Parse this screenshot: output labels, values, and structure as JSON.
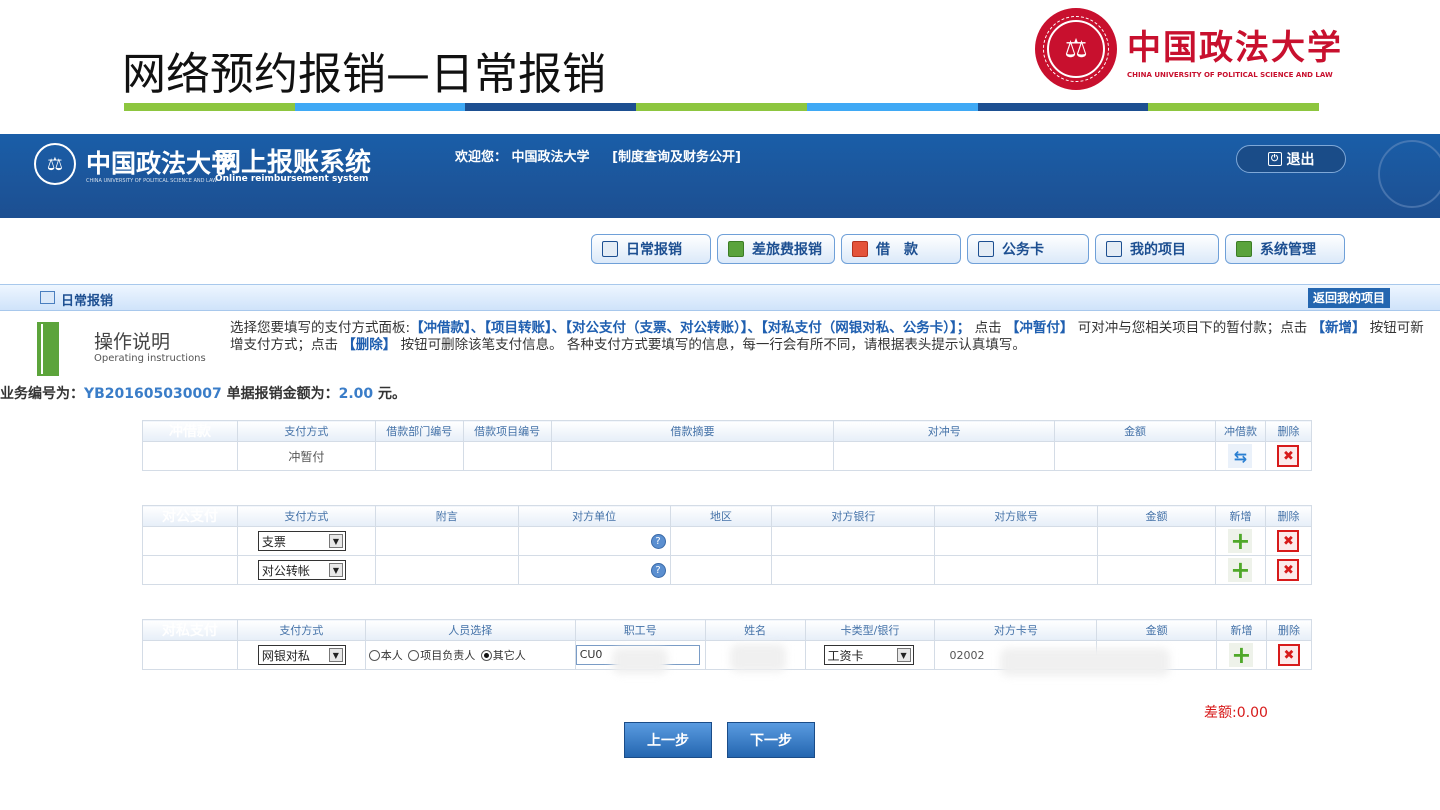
{
  "slide": {
    "title": "网络预约报销—日常报销",
    "title_bar_colors": [
      "#8dc63f",
      "#3fa9f5",
      "#1d4f91",
      "#8dc63f",
      "#3fa9f5",
      "#1d4f91",
      "#8dc63f"
    ],
    "logo_cn": "中国政法大学",
    "logo_en": "CHINA UNIVERSITY OF POLITICAL SCIENCE AND LAW",
    "brand_color": "#c8102e"
  },
  "header": {
    "logo_text": "中国政法大学",
    "logo_sub": "CHINA UNIVERSITY OF POLITICAL SCIENCE AND LAW",
    "system_name": "网上报账系统",
    "system_sub": "Online reimbursement system",
    "welcome": "欢迎您： 中国政法大学",
    "link": "[制度查询及财务公开]",
    "logout": "退出"
  },
  "nav": [
    {
      "label": "日常报销",
      "icon": "document-icon"
    },
    {
      "label": "差旅费报销",
      "icon": "bus-icon"
    },
    {
      "label": "借　款",
      "icon": "loan-icon"
    },
    {
      "label": "公务卡",
      "icon": "card-icon"
    },
    {
      "label": "我的项目",
      "icon": "list-icon"
    },
    {
      "label": "系统管理",
      "icon": "settings-icon"
    }
  ],
  "section": {
    "title": "日常报销",
    "back": "返回我的项目"
  },
  "instructions": {
    "title": "操作说明",
    "subtitle": "Operating instructions",
    "p1": "选择您要填写的支付方式面板:",
    "k1": "【冲借款】、【项目转账】、【对公支付（支票、对公转账）】、【对私支付（网银对私、公务卡）】；",
    "p2": " 点击 ",
    "k2": "【冲暂付】",
    "p3": " 可对冲与您相关项目下的暂付款；点击 ",
    "k3": "【新增】",
    "p4": " 按钮可新增支付方式；点击 ",
    "k4": "【删除】",
    "p5": " 按钮可删除该笔支付信息。 各种支付方式要填写的信息，每一行会有所不同，请根据表头提示认真填写。"
  },
  "business": {
    "label": "业务编号为：",
    "number": "YB201605030007",
    "amount_label": " 单据报销金额为：",
    "amount": "2.00",
    "unit": " 元。"
  },
  "offset": {
    "label": "冲借款",
    "headers": [
      "支付方式",
      "借款部门编号",
      "借款项目编号",
      "借款摘要",
      "对冲号",
      "金额",
      "冲借款",
      "删除"
    ],
    "row": {
      "method": "冲暂付"
    }
  },
  "corporate": {
    "label": "对公支付",
    "headers": [
      "支付方式",
      "附言",
      "对方单位",
      "地区",
      "对方银行",
      "对方账号",
      "金额",
      "新增",
      "删除"
    ],
    "rows": [
      {
        "method": "支票"
      },
      {
        "method": "对公转帐"
      }
    ]
  },
  "private": {
    "label": "对私支付",
    "headers": [
      "支付方式",
      "人员选择",
      "职工号",
      "姓名",
      "卡类型/银行",
      "对方卡号",
      "金额",
      "新增",
      "删除"
    ],
    "row": {
      "method": "网银对私",
      "radio_self": "本人",
      "radio_leader": "项目负责人",
      "radio_other": "其它人",
      "staff_no": "CU0",
      "card_type": "工资卡",
      "card_no": "02002"
    }
  },
  "footer": {
    "diff": "差额:0.00",
    "prev": "上一步",
    "next": "下一步"
  }
}
